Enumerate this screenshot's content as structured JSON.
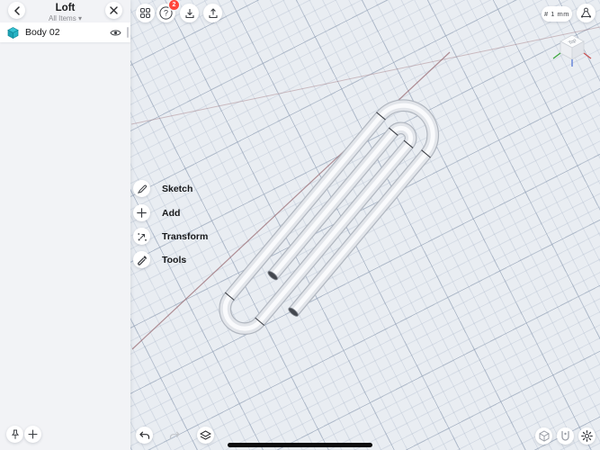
{
  "window": {
    "title": "Loft",
    "subtitle": "All Items",
    "subtitle_caret": "▾"
  },
  "items_panel": {
    "rows": [
      {
        "label": "Body 02"
      }
    ]
  },
  "toolbar": {
    "help_badge": "2"
  },
  "left_menu": {
    "items": [
      "Sketch",
      "Add",
      "Transform",
      "Tools"
    ]
  },
  "canvas": {
    "grid_snap_label": "# 1 mm",
    "view_cube_top_label": "Top"
  },
  "model": {
    "name": "Body 02 (paperclip loft)"
  },
  "colors": {
    "accent_teal": "#1fb6c9",
    "badge_red": "#ff453a",
    "axis_line": "#9b6e75",
    "canvas_bg": "#e9edf2",
    "axis_x_red": "#c94f4f",
    "axis_y_green": "#3aa63a",
    "axis_z_blue": "#4a6fd4"
  }
}
